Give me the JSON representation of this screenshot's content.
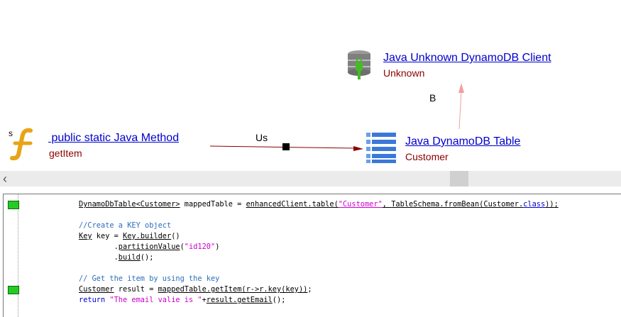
{
  "graph": {
    "method_node": {
      "badge": "s",
      "title": " public static Java Method",
      "subtitle": "getItem"
    },
    "table_node": {
      "title": "Java DynamoDB Table",
      "subtitle": "Customer"
    },
    "client_node": {
      "title": "Java Unknown DynamoDB Client",
      "subtitle": "Unknown"
    },
    "edges": [
      {
        "label": "Us",
        "color": "#8b0000"
      },
      {
        "label": "B",
        "color": "#f0a0a0"
      }
    ]
  },
  "scrollbar": {
    "left_arrow": "‹"
  },
  "code": {
    "lines": [
      {
        "marker": true,
        "parts": [
          {
            "t": "DynamoDbTable<Customer>",
            "c": "u"
          },
          {
            "t": " mappedTable = ",
            "c": ""
          },
          {
            "t": "enhancedClient.table(",
            "c": "u"
          },
          {
            "t": "\"Customer\"",
            "c": "u str"
          },
          {
            "t": ", ",
            "c": "u"
          },
          {
            "t": "TableSchema.fromBean(Customer.",
            "c": "u"
          },
          {
            "t": "class",
            "c": "u kw"
          },
          {
            "t": "));",
            "c": "u"
          }
        ]
      },
      {
        "marker": false,
        "parts": []
      },
      {
        "marker": false,
        "parts": [
          {
            "t": "//Create a KEY object",
            "c": "cmt"
          }
        ]
      },
      {
        "marker": false,
        "parts": [
          {
            "t": "Key",
            "c": "u"
          },
          {
            "t": " key = ",
            "c": ""
          },
          {
            "t": "Key.builder",
            "c": "u"
          },
          {
            "t": "()",
            "c": ""
          }
        ]
      },
      {
        "marker": false,
        "parts": [
          {
            "t": "        .",
            "c": ""
          },
          {
            "t": "partitionValue",
            "c": "u"
          },
          {
            "t": "(",
            "c": ""
          },
          {
            "t": "\"id120\"",
            "c": "str"
          },
          {
            "t": ")",
            "c": ""
          }
        ]
      },
      {
        "marker": false,
        "parts": [
          {
            "t": "        .",
            "c": ""
          },
          {
            "t": "build",
            "c": "u"
          },
          {
            "t": "();",
            "c": ""
          }
        ]
      },
      {
        "marker": false,
        "parts": []
      },
      {
        "marker": false,
        "parts": [
          {
            "t": "// Get the item by using the key",
            "c": "cmt"
          }
        ]
      },
      {
        "marker": true,
        "parts": [
          {
            "t": "Customer",
            "c": "u"
          },
          {
            "t": " result = ",
            "c": ""
          },
          {
            "t": "mappedTable.getItem(r->r.key(key))",
            "c": "u"
          },
          {
            "t": ";",
            "c": ""
          }
        ]
      },
      {
        "marker": false,
        "parts": [
          {
            "t": "return",
            "c": "kw"
          },
          {
            "t": " ",
            "c": ""
          },
          {
            "t": "\"The email valie is \"",
            "c": "str"
          },
          {
            "t": "+",
            "c": ""
          },
          {
            "t": "result.getEmail",
            "c": "u"
          },
          {
            "t": "();",
            "c": ""
          }
        ]
      }
    ]
  }
}
